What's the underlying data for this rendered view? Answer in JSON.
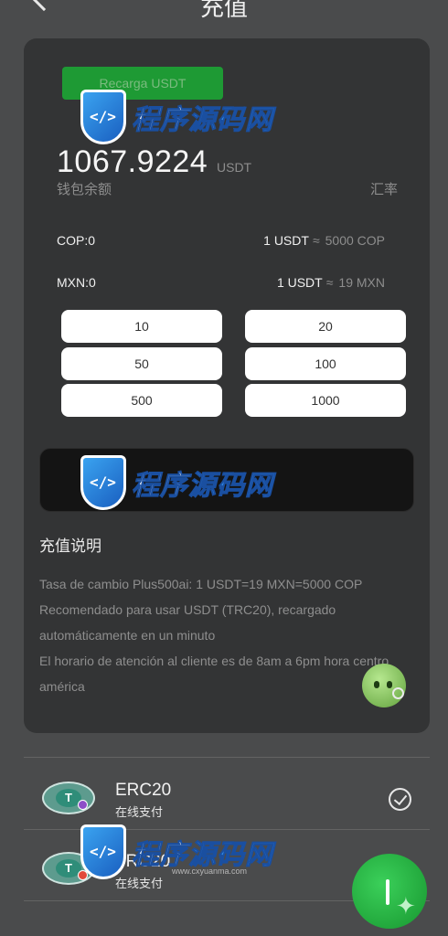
{
  "header": {
    "title": "充值"
  },
  "recharge": {
    "button_label": "Recarga USDT",
    "balance_value": "1067.9224",
    "balance_unit": "USDT",
    "balance_label": "钱包余额",
    "rate_label": "汇率",
    "rates": [
      {
        "currency": "COP:0",
        "lhs": "1 USDT",
        "approx": "≈",
        "rhs": "5000 COP"
      },
      {
        "currency": "MXN:0",
        "lhs": "1 USDT",
        "approx": "≈",
        "rhs": "19 MXN"
      }
    ],
    "amounts": [
      "10",
      "20",
      "50",
      "100",
      "500",
      "1000"
    ],
    "amount_input_value": ""
  },
  "notes": {
    "title": "充值说明",
    "lines": [
      "Tasa de cambio Plus500ai: 1 USDT=19 MXN=5000 COP",
      "Recomendado para usar USDT (TRC20), recargado automáticamente en un minuto",
      "El horario de atención al cliente es de 8am a 6pm hora centro américa"
    ]
  },
  "watermark": {
    "text_a": "程序",
    "text_b": "源码网",
    "url": "www.cxyuanma.com"
  },
  "payments": [
    {
      "name": "ERC20",
      "sub": "在线支付",
      "selected": true,
      "dot_color": "#8e4fc8"
    },
    {
      "name": "TRC20",
      "sub": "在线支付",
      "selected": false,
      "dot_color": "#e24a3b"
    }
  ],
  "icons": {
    "back": "chevron-left-icon",
    "check": "check-circle-icon",
    "chat": "chat-bubble-icon",
    "fab": "floating-service-icon",
    "tether": "tether-coin-icon"
  },
  "colors": {
    "accent_green": "#1e9a34",
    "card_bg": "#333435",
    "page_bg": "#4a4b4c"
  }
}
